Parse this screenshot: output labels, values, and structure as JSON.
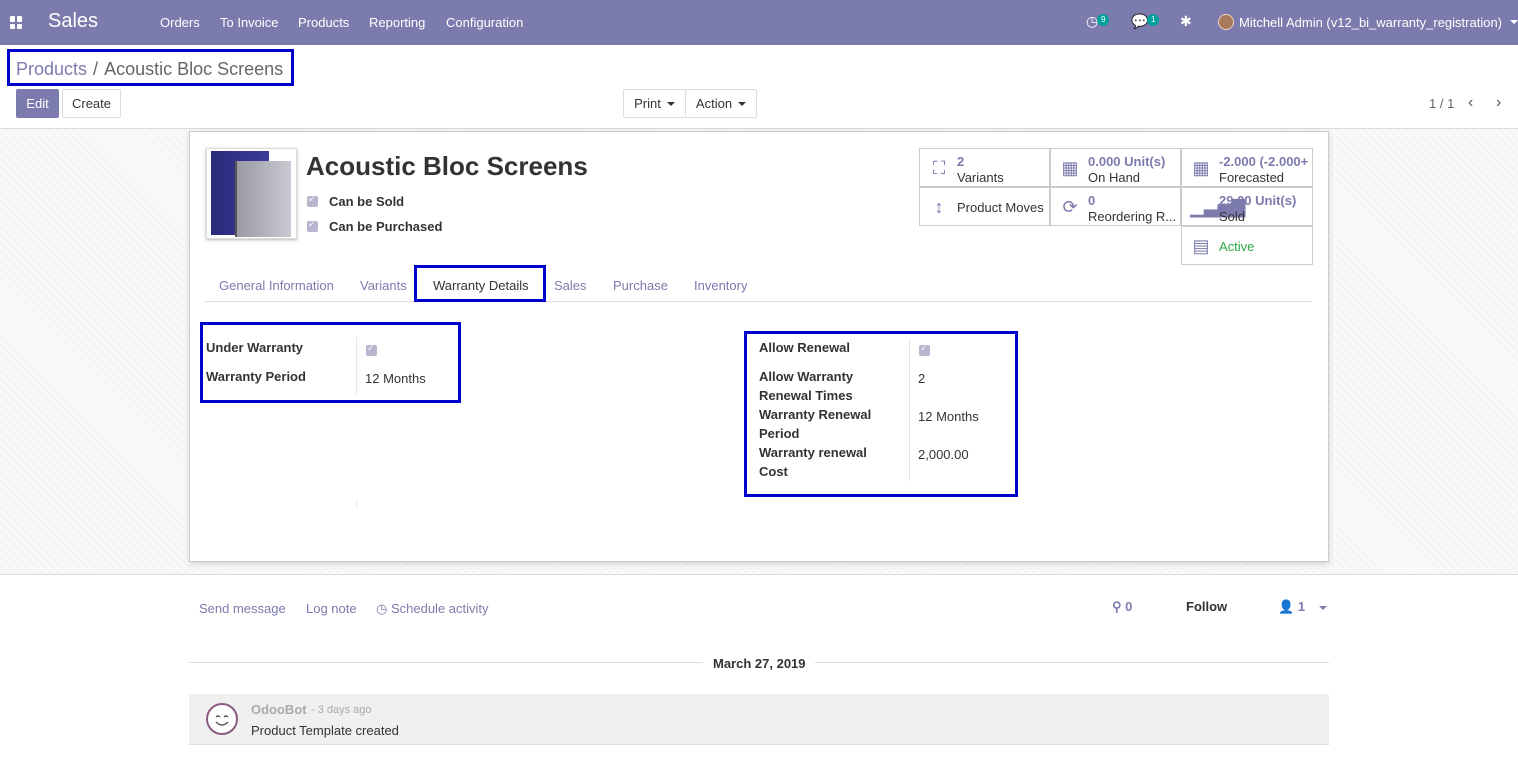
{
  "navbar": {
    "brand": "Sales",
    "menu": [
      "Orders",
      "To Invoice",
      "Products",
      "Reporting",
      "Configuration"
    ],
    "activity_count": "9",
    "message_count": "1",
    "user": "Mitchell Admin (v12_bi_warranty_registration)"
  },
  "breadcrumb": {
    "parent": "Products",
    "separator": "/",
    "current": "Acoustic Bloc Screens"
  },
  "controls": {
    "edit": "Edit",
    "create": "Create",
    "print": "Print",
    "action": "Action",
    "pager": "1 / 1"
  },
  "product": {
    "name": "Acoustic Bloc Screens",
    "can_be_sold": "Can be Sold",
    "can_be_purchased": "Can be Purchased"
  },
  "smart_buttons": {
    "variants_value": "2",
    "variants_label": "Variants",
    "onhand_value": "0.000 Unit(s)",
    "onhand_label": "On Hand",
    "forecast_value": "-2.000 (-2.000+",
    "forecast_label": "Forecasted",
    "moves_label": "Product Moves",
    "reorder_value": "0",
    "reorder_label": "Reordering R...",
    "sold_value": "29.00 Unit(s)",
    "sold_label": "Sold",
    "active_label": "Active"
  },
  "tabs": [
    "General Information",
    "Variants",
    "Warranty Details",
    "Sales",
    "Purchase",
    "Inventory"
  ],
  "warranty": {
    "under_warranty_label": "Under Warranty",
    "period_label": "Warranty Period",
    "period_value": "12 Months",
    "allow_renewal_label": "Allow Renewal",
    "renewal_times_label_1": "Allow Warranty",
    "renewal_times_label_2": "Renewal Times",
    "renewal_times_value": "2",
    "renewal_period_label_1": "Warranty Renewal",
    "renewal_period_label_2": "Period",
    "renewal_period_value": "12 Months",
    "renewal_cost_label_1": "Warranty renewal",
    "renewal_cost_label_2": "Cost",
    "renewal_cost_value": "2,000.00"
  },
  "chatter": {
    "send_message": "Send message",
    "log_note": "Log note",
    "schedule_activity": "Schedule activity",
    "attachments": "0",
    "follow": "Follow",
    "followers": "1",
    "date": "March 27, 2019",
    "author": "OdooBot",
    "time": "- 3 days ago",
    "body": "Product Template created"
  },
  "colors": {
    "brand": "#7c7bad",
    "highlight": "#0000cc",
    "active": "#28a745"
  }
}
